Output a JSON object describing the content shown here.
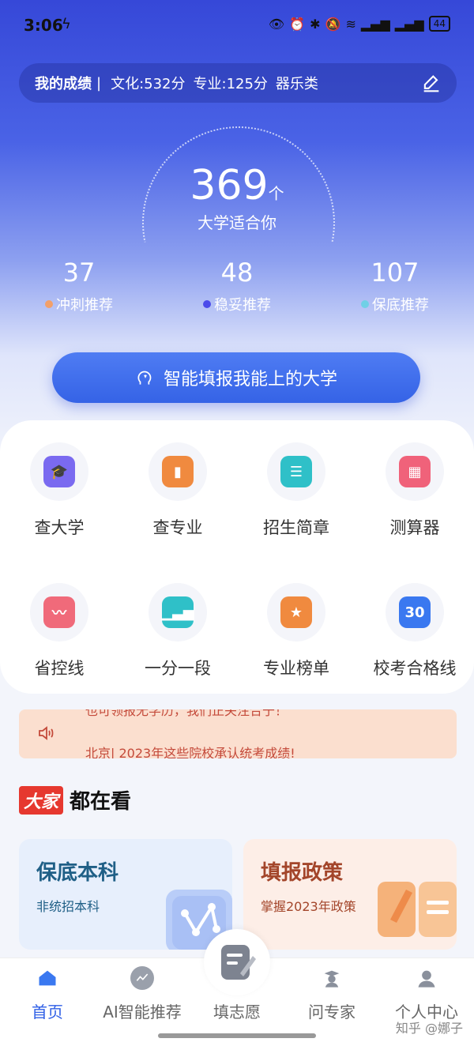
{
  "status_bar": {
    "time": "3:06",
    "battery": "44"
  },
  "scores": {
    "title": "我的成绩",
    "separator": "|",
    "culture": "文化:532分",
    "major": "专业:125分",
    "category": "器乐类"
  },
  "summary": {
    "count": "369",
    "unit": "个",
    "label": "大学适合你",
    "stats": [
      {
        "value": "37",
        "label": "冲刺推荐",
        "color": "#f2a06a"
      },
      {
        "value": "48",
        "label": "稳妥推荐",
        "color": "#4b4bea"
      },
      {
        "value": "107",
        "label": "保底推荐",
        "color": "#6fd0e6"
      }
    ]
  },
  "cta": {
    "label": "智能填报我能上的大学"
  },
  "tools": [
    {
      "label": "查大学",
      "icon": "graduation-cap-icon",
      "color": "#7a6af0"
    },
    {
      "label": "查专业",
      "icon": "bookmark-book-icon",
      "color": "#f08a3f"
    },
    {
      "label": "招生简章",
      "icon": "document-icon",
      "color": "#2fc0c8"
    },
    {
      "label": "测算器",
      "icon": "calculator-icon",
      "color": "#f0627a"
    },
    {
      "label": "省控线",
      "icon": "trend-chart-icon",
      "color": "#f06a7a"
    },
    {
      "label": "一分一段",
      "icon": "bar-chart-icon",
      "color": "#2fc0c8"
    },
    {
      "label": "专业榜单",
      "icon": "star-badge-icon",
      "color": "#f08a3f"
    },
    {
      "label": "校考合格线",
      "icon": "calendar-icon",
      "color": "#3a78f0",
      "icon_text": "30"
    }
  ],
  "notice": {
    "line_prev": "也可领报无学历，我们正关注合于！",
    "line_current": "北京| 2023年这些院校承认统考成绩!"
  },
  "section": {
    "badge": "大家",
    "title": "都在看"
  },
  "cards": [
    {
      "title": "保底本科",
      "subtitle": "非统招本科"
    },
    {
      "title": "填报政策",
      "subtitle": "掌握2023年政策"
    }
  ],
  "tabs": [
    {
      "label": "首页",
      "icon": "home-icon",
      "active": true
    },
    {
      "label": "AI智能推荐",
      "icon": "ai-icon",
      "active": false
    },
    {
      "label": "填志愿",
      "icon": "fill-form-icon",
      "active": false
    },
    {
      "label": "问专家",
      "icon": "expert-icon",
      "active": false
    },
    {
      "label": "个人中心",
      "icon": "profile-icon",
      "active": false
    }
  ],
  "watermark": "知乎 @娜子"
}
